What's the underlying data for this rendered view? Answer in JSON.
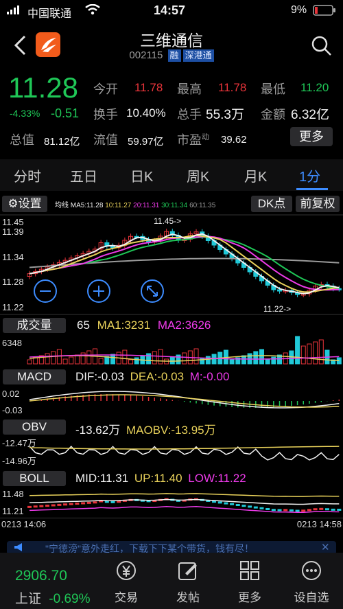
{
  "status_bar": {
    "carrier": "中国联通",
    "time": "14:57",
    "battery": "9%"
  },
  "header": {
    "title": "三维通信",
    "code": "002115",
    "tags": [
      "融",
      "深港通"
    ]
  },
  "quote": {
    "price": "11.28",
    "change_pct": "-4.33%",
    "change": "-0.51",
    "rows": [
      [
        {
          "label": "今开",
          "value": "11.78"
        },
        {
          "label": "最高",
          "value": "11.78"
        },
        {
          "label": "最低",
          "value": "11.20"
        }
      ],
      [
        {
          "label": "换手",
          "value": "10.40%"
        },
        {
          "label": "总手",
          "value": "55.3万"
        },
        {
          "label": "金额",
          "value": "6.32亿"
        }
      ],
      [
        {
          "label": "总值",
          "value": "81.12亿"
        },
        {
          "label": "流值",
          "value": "59.97亿"
        },
        {
          "label": "市盈",
          "sup": "动",
          "value": "39.62"
        }
      ]
    ],
    "more_label": "更多"
  },
  "tabs": [
    "分时",
    "五日",
    "日K",
    "周K",
    "月K",
    "1分"
  ],
  "active_tab": "1分",
  "chart_toolbar": {
    "settings_label": "设置",
    "ma_legend": {
      "label": "均线",
      "ma5": "MA5:11.28",
      "ma10": "10:11.27",
      "ma20": "20:11.31",
      "ma30": "30:11.34",
      "ma60": "60:11.35"
    },
    "dk_label": "DK点",
    "adjust_label": "前复权"
  },
  "main_chart": {
    "y_ticks": [
      "11.45",
      "11.39",
      "11.34",
      "11.28",
      "11.22"
    ],
    "max_marker": "11.45->",
    "min_marker": "11.22->"
  },
  "volume": {
    "button": "成交量",
    "value": "65",
    "ma1": "MA1:3231",
    "ma2": "MA2:3626",
    "axis_top": "6348"
  },
  "macd": {
    "button": "MACD",
    "dif": "DIF:-0.03",
    "dea": "DEA:-0.03",
    "m": "M:-0.00",
    "axis_top": "0.02",
    "axis_bottom": "-0.03"
  },
  "obv": {
    "button": "OBV",
    "value": "-13.62万",
    "maobv": "MAOBV:-13.95万",
    "axis_top": "-12.47万",
    "axis_bottom": "-14.96万"
  },
  "boll": {
    "button": "BOLL",
    "mid": "MID:11.31",
    "up": "UP:11.40",
    "low": "LOW:11.22",
    "axis_top": "11.48",
    "axis_bottom": "11.21"
  },
  "time_axis": {
    "start": "0213 14:06",
    "end": "0213 14:58"
  },
  "banner": {
    "text": "\"宁徳滂\"意外走红，下载下下某个带货，钱有尽！"
  },
  "bottom_bar": {
    "index_value": "2906.70",
    "index_name": "上证",
    "index_change": "-0.69%",
    "items": [
      "交易",
      "发帖",
      "更多",
      "设自选"
    ]
  },
  "colors": {
    "up": "#e8343a",
    "down": "#1fc757",
    "accent": "#3d8cff",
    "candle_down": "#20c9d8"
  }
}
